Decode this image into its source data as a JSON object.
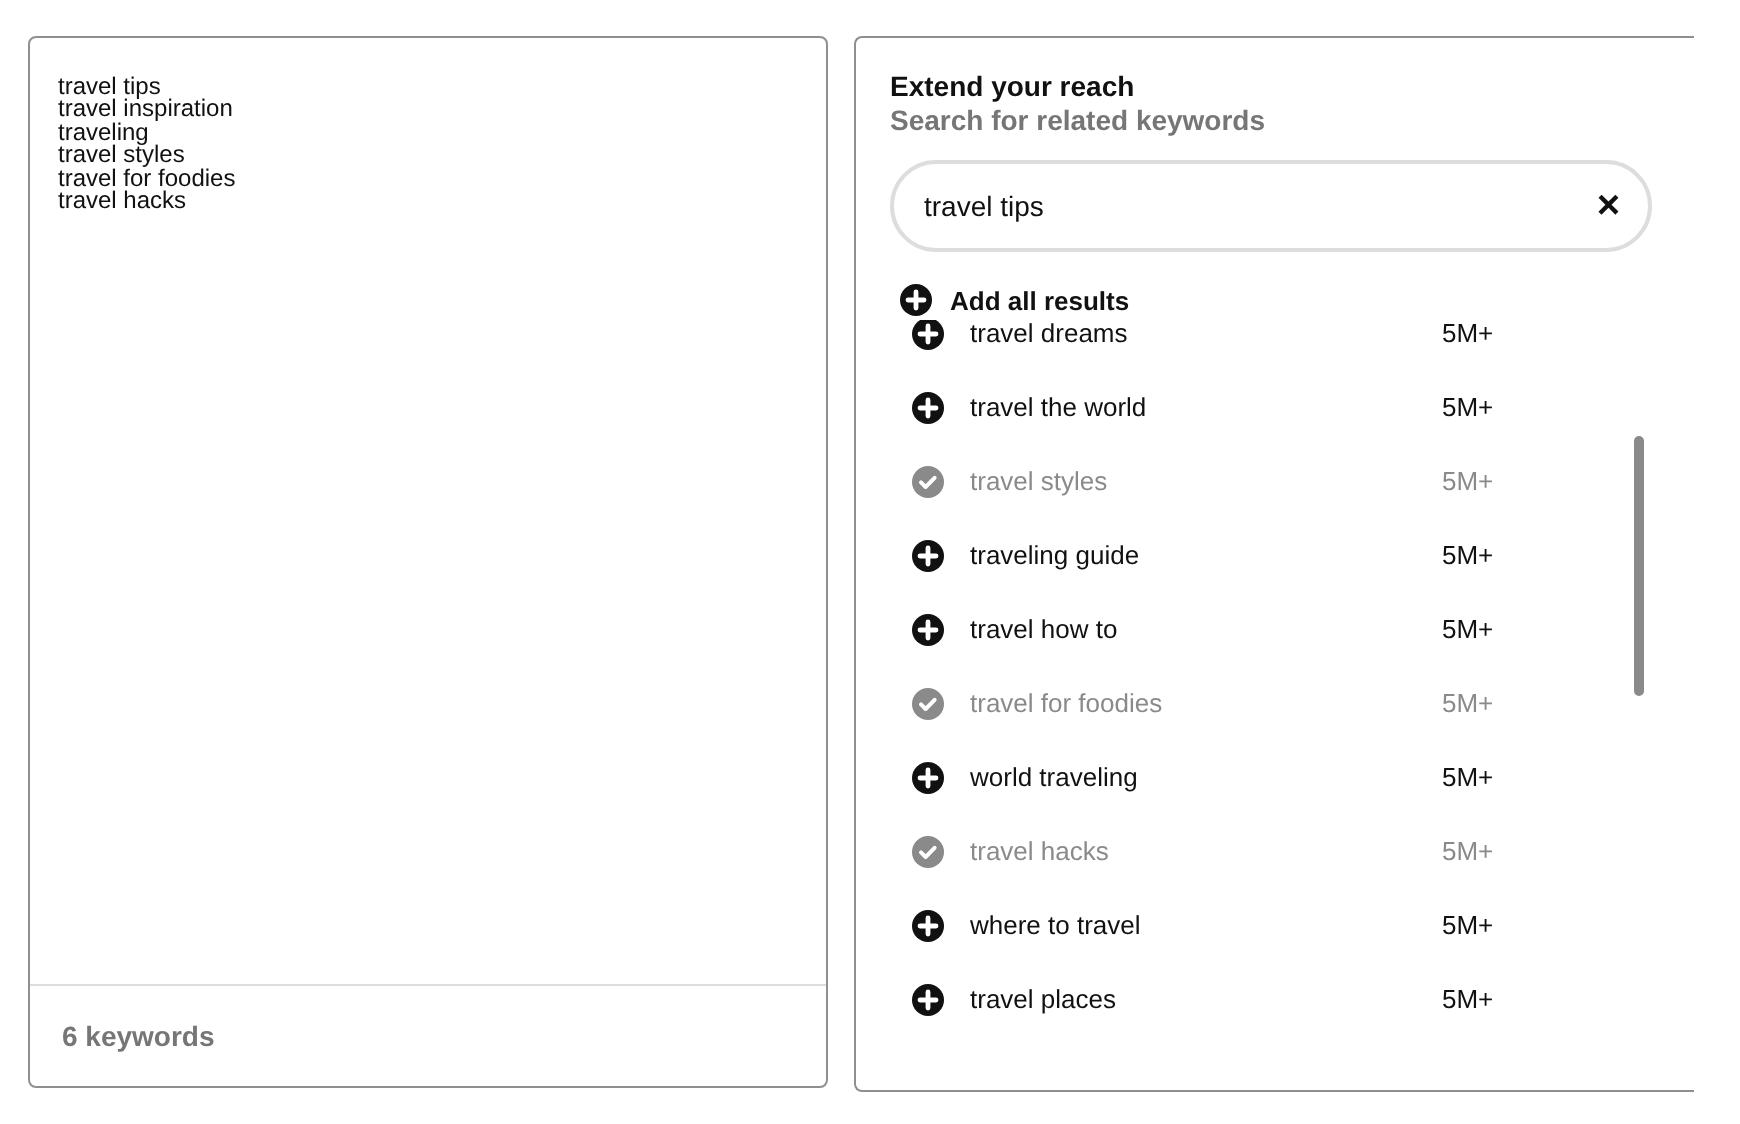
{
  "keyword_list": {
    "items": [
      "travel tips",
      "travel inspiration",
      "traveling",
      "travel styles",
      "travel for foodies",
      "travel hacks"
    ],
    "count": "6 keywords"
  },
  "related": {
    "title": "Extend your reach",
    "subtitle": "Search for related keywords",
    "search": {
      "value": "travel tips",
      "clear": "×"
    },
    "add_all": "Add all results",
    "results": [
      {
        "keyword": "travel dreams",
        "volume": "5M+",
        "added": false
      },
      {
        "keyword": "travel the world",
        "volume": "5M+",
        "added": false
      },
      {
        "keyword": "travel styles",
        "volume": "5M+",
        "added": true
      },
      {
        "keyword": "traveling guide",
        "volume": "5M+",
        "added": false
      },
      {
        "keyword": "travel how to",
        "volume": "5M+",
        "added": false
      },
      {
        "keyword": "travel for foodies",
        "volume": "5M+",
        "added": true
      },
      {
        "keyword": "world traveling",
        "volume": "5M+",
        "added": false
      },
      {
        "keyword": "travel hacks",
        "volume": "5M+",
        "added": true
      },
      {
        "keyword": "where to travel",
        "volume": "5M+",
        "added": false
      },
      {
        "keyword": "travel places",
        "volume": "5M+",
        "added": false
      }
    ]
  }
}
